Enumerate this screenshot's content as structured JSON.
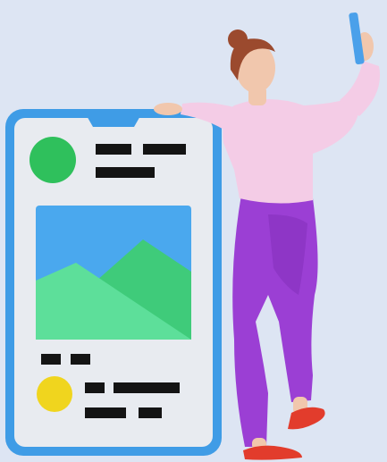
{
  "colors": {
    "background": "#dde5f3",
    "phone_frame": "#3f9ce6",
    "phone_screen": "#e8ebf0",
    "avatar_green": "#2fc05c",
    "avatar_yellow": "#f0d51e",
    "image_sky": "#4aa8ee",
    "mountain_front": "#5ddf9a",
    "mountain_back": "#3fcb7a",
    "text_bars": "#141414",
    "sweater": "#f4cce6",
    "pants": "#9b3fd4",
    "shoes": "#e23c2c",
    "skin": "#f1c7ad",
    "hair": "#9b4a2e",
    "held_phone": "#4aa0ea"
  },
  "icons": {
    "post_avatar_top": "avatar-circle-icon",
    "post_image": "landscape-image-icon",
    "post_avatar_bottom": "avatar-circle-icon",
    "held_phone": "smartphone-icon"
  }
}
